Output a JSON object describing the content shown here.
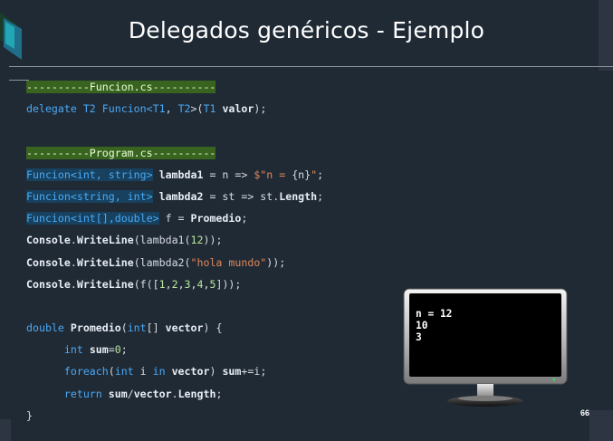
{
  "slide": {
    "title": "Delegados genéricos - Ejemplo",
    "page_number": "66"
  },
  "code_lines": [
    {
      "parts": [
        {
          "t": "----------Funcion.cs----------",
          "c": "hl-green"
        }
      ]
    },
    {
      "parts": [
        {
          "t": "delegate ",
          "c": "kw"
        },
        {
          "t": "T2 ",
          "c": "ty"
        },
        {
          "t": "Funcion<",
          "c": "ty"
        },
        {
          "t": "T1",
          "c": "ty"
        },
        {
          "t": ", ",
          "c": ""
        },
        {
          "t": "T2",
          "c": "ty"
        },
        {
          "t": ">(",
          "c": ""
        },
        {
          "t": "T1 ",
          "c": "ty"
        },
        {
          "t": "valor",
          "c": "id"
        },
        {
          "t": ");",
          "c": ""
        }
      ]
    },
    {
      "parts": [
        {
          "t": "",
          "c": ""
        }
      ]
    },
    {
      "parts": [
        {
          "t": "----------Program.cs----------",
          "c": "hl-green"
        }
      ]
    },
    {
      "parts": [
        {
          "t": "Funcion<int, string>",
          "c": "ty hl-blue"
        },
        {
          "t": " ",
          "c": ""
        },
        {
          "t": "lambda1",
          "c": "id"
        },
        {
          "t": " = n => ",
          "c": ""
        },
        {
          "t": "$\"n = ",
          "c": "str"
        },
        {
          "t": "{n}",
          "c": ""
        },
        {
          "t": "\"",
          "c": "str"
        },
        {
          "t": ";",
          "c": ""
        }
      ]
    },
    {
      "parts": [
        {
          "t": "Funcion<string, int>",
          "c": "ty hl-blue"
        },
        {
          "t": " ",
          "c": ""
        },
        {
          "t": "lambda2",
          "c": "id"
        },
        {
          "t": " = st => st.",
          "c": ""
        },
        {
          "t": "Length",
          "c": "id"
        },
        {
          "t": ";",
          "c": ""
        }
      ]
    },
    {
      "parts": [
        {
          "t": "Funcion<int[],double>",
          "c": "ty hl-blue"
        },
        {
          "t": " f = ",
          "c": ""
        },
        {
          "t": "Promedio",
          "c": "id"
        },
        {
          "t": ";",
          "c": ""
        }
      ]
    },
    {
      "parts": [
        {
          "t": "Console",
          "c": "id"
        },
        {
          "t": ".",
          "c": ""
        },
        {
          "t": "WriteLine",
          "c": "id"
        },
        {
          "t": "(lambda1(",
          "c": ""
        },
        {
          "t": "12",
          "c": "num"
        },
        {
          "t": "));",
          "c": ""
        }
      ]
    },
    {
      "parts": [
        {
          "t": "Console",
          "c": "id"
        },
        {
          "t": ".",
          "c": ""
        },
        {
          "t": "WriteLine",
          "c": "id"
        },
        {
          "t": "(lambda2(",
          "c": ""
        },
        {
          "t": "\"hola mundo\"",
          "c": "str"
        },
        {
          "t": "));",
          "c": ""
        }
      ]
    },
    {
      "parts": [
        {
          "t": "Console",
          "c": "id"
        },
        {
          "t": ".",
          "c": ""
        },
        {
          "t": "WriteLine",
          "c": "id"
        },
        {
          "t": "(f([",
          "c": ""
        },
        {
          "t": "1",
          "c": "num"
        },
        {
          "t": ",",
          "c": ""
        },
        {
          "t": "2",
          "c": "num"
        },
        {
          "t": ",",
          "c": ""
        },
        {
          "t": "3",
          "c": "num"
        },
        {
          "t": ",",
          "c": ""
        },
        {
          "t": "4",
          "c": "num"
        },
        {
          "t": ",",
          "c": ""
        },
        {
          "t": "5",
          "c": "num"
        },
        {
          "t": "]));",
          "c": ""
        }
      ]
    },
    {
      "parts": [
        {
          "t": "",
          "c": ""
        }
      ]
    },
    {
      "parts": [
        {
          "t": "double ",
          "c": "kw"
        },
        {
          "t": "Promedio",
          "c": "id"
        },
        {
          "t": "(",
          "c": ""
        },
        {
          "t": "int",
          "c": "kw"
        },
        {
          "t": "[] ",
          "c": ""
        },
        {
          "t": "vector",
          "c": "id"
        },
        {
          "t": ") {",
          "c": ""
        }
      ]
    },
    {
      "parts": [
        {
          "t": "      int ",
          "c": "kw"
        },
        {
          "t": "sum",
          "c": "id"
        },
        {
          "t": "=",
          "c": ""
        },
        {
          "t": "0",
          "c": "num"
        },
        {
          "t": ";",
          "c": ""
        }
      ]
    },
    {
      "parts": [
        {
          "t": "      foreach",
          "c": "kw"
        },
        {
          "t": "(",
          "c": ""
        },
        {
          "t": "int ",
          "c": "kw"
        },
        {
          "t": "i ",
          "c": ""
        },
        {
          "t": "in ",
          "c": "kw"
        },
        {
          "t": "vector",
          "c": "id"
        },
        {
          "t": ") ",
          "c": ""
        },
        {
          "t": "sum",
          "c": "id"
        },
        {
          "t": "+=i;",
          "c": ""
        }
      ]
    },
    {
      "parts": [
        {
          "t": "      return ",
          "c": "kw"
        },
        {
          "t": "sum",
          "c": "id"
        },
        {
          "t": "/",
          "c": ""
        },
        {
          "t": "vector",
          "c": "id"
        },
        {
          "t": ".",
          "c": ""
        },
        {
          "t": "Length",
          "c": "id"
        },
        {
          "t": ";",
          "c": ""
        }
      ]
    },
    {
      "parts": [
        {
          "t": "}",
          "c": ""
        }
      ]
    }
  ],
  "console": {
    "output": "n = 12\n10\n3"
  },
  "colors": {
    "background": "#202a35",
    "keyword": "#4aa9f5",
    "string": "#e0875a",
    "number": "#b8e59a",
    "highlight_green": "#39641f",
    "highlight_blue": "#17415f"
  },
  "icons": {
    "monitor": "monitor-icon",
    "corner": "triangle-deco-icon"
  }
}
